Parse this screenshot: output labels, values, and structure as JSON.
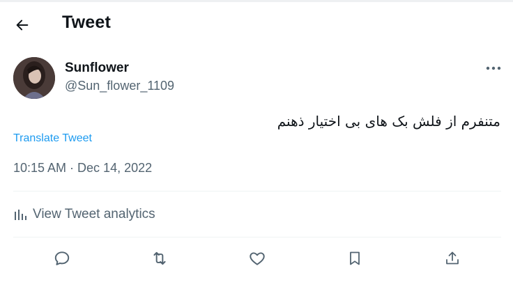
{
  "header": {
    "title": "Tweet",
    "back_icon": "arrow-left-icon"
  },
  "author": {
    "name": "Sunflower",
    "handle": "@Sun_flower_1109",
    "avatar": "profile-photo",
    "more_icon": "more-horizontal-icon"
  },
  "tweet": {
    "text": "متنفرم از فلش بک های بی اختیار ذهنم",
    "translate_label": "Translate Tweet",
    "timestamp": "10:15 AM · Dec 14, 2022"
  },
  "analytics": {
    "icon": "bar-chart-icon",
    "label": "View Tweet analytics"
  },
  "actions": [
    {
      "icon": "reply-icon"
    },
    {
      "icon": "retweet-icon"
    },
    {
      "icon": "like-icon"
    },
    {
      "icon": "bookmark-icon"
    },
    {
      "icon": "share-icon"
    }
  ],
  "colors": {
    "link": "#1d9bf0",
    "secondary_text": "#536471",
    "primary_text": "#0f1419",
    "divider": "#eff3f4"
  }
}
